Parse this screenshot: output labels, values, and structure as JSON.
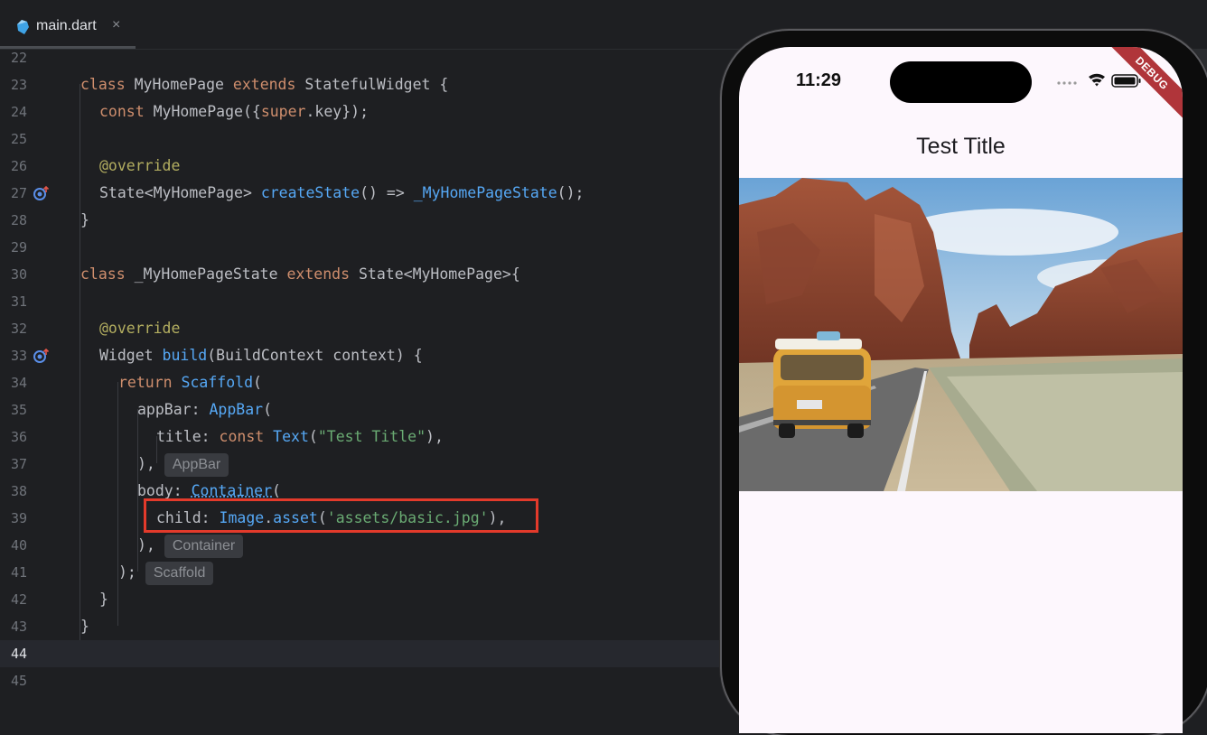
{
  "tab": {
    "filename": "main.dart",
    "close": "×"
  },
  "editor": {
    "lines": [
      {
        "n": "22"
      },
      {
        "n": "23"
      },
      {
        "n": "24"
      },
      {
        "n": "25"
      },
      {
        "n": "26"
      },
      {
        "n": "27"
      },
      {
        "n": "28"
      },
      {
        "n": "29"
      },
      {
        "n": "30"
      },
      {
        "n": "31"
      },
      {
        "n": "32"
      },
      {
        "n": "33"
      },
      {
        "n": "34"
      },
      {
        "n": "35"
      },
      {
        "n": "36"
      },
      {
        "n": "37"
      },
      {
        "n": "38"
      },
      {
        "n": "39"
      },
      {
        "n": "40"
      },
      {
        "n": "41"
      },
      {
        "n": "42"
      },
      {
        "n": "43"
      },
      {
        "n": "44"
      },
      {
        "n": "45"
      }
    ],
    "code": {
      "l23": {
        "kw1": "class",
        "name": " MyHomePage ",
        "kw2": "extends",
        "rest": " StatefulWidget {"
      },
      "l24": {
        "kw": "const",
        "name": " MyHomePage({",
        "sup": "super",
        "rest": ".key});"
      },
      "l26": {
        "ann": "@override"
      },
      "l27": {
        "pre": "State<MyHomePage> ",
        "fn": "createState",
        "mid": "() => ",
        "fn2": "_MyHomePageState",
        "rest": "();"
      },
      "l28": {
        "text": "}"
      },
      "l30": {
        "kw1": "class",
        "name": " _MyHomePageState ",
        "kw2": "extends",
        "rest": " State<MyHomePage>{"
      },
      "l32": {
        "ann": "@override"
      },
      "l33": {
        "pre": "Widget ",
        "fn": "build",
        "rest": "(BuildContext context) {"
      },
      "l34": {
        "kw": "return",
        "fn": " Scaffold",
        "rest": "("
      },
      "l35": {
        "pre": "appBar: ",
        "fn": "AppBar",
        "rest": "("
      },
      "l36": {
        "pre": "title: ",
        "kw": "const",
        "fn": " Text",
        "p": "(",
        "str": "\"Test Title\"",
        "rest": "),"
      },
      "l37": {
        "text": "),",
        "hint": "AppBar"
      },
      "l38": {
        "pre": "body: ",
        "fn": "Container",
        "rest": "("
      },
      "l39": {
        "pre": "child: ",
        "fn": "Image",
        "dot": ".",
        "fn2": "asset",
        "p": "(",
        "str": "'assets/basic.jpg'",
        "rest": "),"
      },
      "l40": {
        "text": "),",
        "hint": "Container"
      },
      "l41": {
        "text": ");",
        "hint": "Scaffold"
      },
      "l42": {
        "text": "}"
      },
      "l43": {
        "text": "}"
      }
    },
    "current_line": "44",
    "gutter_icons": [
      "override-marker-icon",
      "override-marker-icon"
    ]
  },
  "phone": {
    "time": "11:29",
    "debug": "DEBUG",
    "app_title": "Test Title",
    "image_alt": "desert road with yellow van"
  },
  "colors": {
    "highlight": "#e33a2b",
    "keyword": "#cf8e6d",
    "function": "#56a8f5",
    "string": "#6aab73",
    "annotation": "#b3ae60"
  }
}
